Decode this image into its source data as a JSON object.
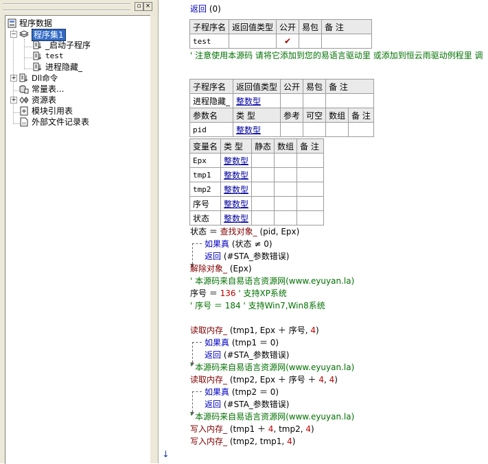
{
  "tree": {
    "root_label": "程序数据",
    "items": [
      {
        "label": "程序集1",
        "selected": true
      },
      {
        "label": "_启动子程序"
      },
      {
        "label": "test"
      },
      {
        "label": "进程隐藏_"
      },
      {
        "label": "Dll命令"
      },
      {
        "label": "常量表..."
      },
      {
        "label": "资源表"
      },
      {
        "label": "模块引用表"
      },
      {
        "label": "外部文件记录表"
      }
    ],
    "buttons": {
      "restore": "▫",
      "close": "×"
    }
  },
  "code": {
    "return_line": {
      "kw": "返回",
      "args": " (0)"
    },
    "table1": {
      "headers": [
        "子程序名",
        "返回值类型",
        "公开",
        "易包",
        "备 注"
      ],
      "row": [
        "test",
        "",
        "✔",
        "",
        ""
      ]
    },
    "note_comment": "' 注意使用本源码 请将它添加到您的易语言驱动里 或添加到恒云雨驱动例程里 调",
    "table2": {
      "headers": [
        "子程序名",
        "返回值类型",
        "公开",
        "易包",
        "备 注"
      ],
      "row": [
        "进程隐藏_",
        "整数型",
        "",
        "",
        ""
      ],
      "param_headers": [
        "参数名",
        "类 型",
        "参考",
        "可空",
        "数组",
        "备 注"
      ],
      "param_row": [
        "pid",
        "整数型",
        "",
        "",
        "",
        ""
      ]
    },
    "table3": {
      "headers": [
        "变量名",
        "类 型",
        "静态",
        "数组",
        "备 注"
      ],
      "rows": [
        [
          "Epx",
          "整数型"
        ],
        [
          "tmp1",
          "整数型"
        ],
        [
          "tmp2",
          "整数型"
        ],
        [
          "序号",
          "整数型"
        ],
        [
          "状态",
          "整数型"
        ]
      ]
    },
    "lines": {
      "l1_a": "状态 ＝ ",
      "l1_fn": "查找对象_",
      "l1_b": " (pid, Epx)",
      "l2_kw": "如果真",
      "l2_b": " (状态 ≠ 0)",
      "l3_kw": "返回",
      "l3_b": " (#STA_参数错误)",
      "l4_fn": "解除对象_",
      "l4_b": " (Epx)",
      "l5": "' 本源码来自易语言资源网(www.eyuyan.la)",
      "l6_a": "序号 ＝ ",
      "l6_num": "136",
      "l6_c": "  ' 支持XP系统",
      "l7": "' 序号 ＝ 184  ' 支持Win7,Win8系统",
      "l8_fn": "读取内存_",
      "l8_b": " (tmp1, Epx ＋ 序号, ",
      "l8_num": "4",
      "l8_c": ")",
      "l9_kw": "如果真",
      "l9_b": " (tmp1 ＝ 0)",
      "l10_kw": "返回",
      "l10_b": " (#STA_参数错误)",
      "l11": "' 本源码来自易语言资源网(www.eyuyan.la)",
      "l12_fn": "读取内存_",
      "l12_b": " (tmp2, Epx ＋ 序号 ＋ ",
      "l12_num1": "4",
      "l12_c": ", ",
      "l12_num2": "4",
      "l12_d": ")",
      "l13_kw": "如果真",
      "l13_b": " (tmp2 ＝ 0)",
      "l14_kw": "返回",
      "l14_b": " (#STA_参数错误)",
      "l15": "' 本源码来自易语言资源网(www.eyuyan.la)",
      "l16_fn": "写入内存_",
      "l16_b": " (tmp1 ＋ ",
      "l16_num": "4",
      "l16_c": ", tmp2, ",
      "l16_num2": "4",
      "l16_d": ")",
      "l17_fn": "写入内存_",
      "l17_b": " (tmp2, tmp1, ",
      "l17_num": "4",
      "l17_c": ")"
    }
  },
  "colors": {
    "selection": "#316ac5",
    "keyword": "#0000c0",
    "comment": "#007000",
    "function": "#800000"
  }
}
